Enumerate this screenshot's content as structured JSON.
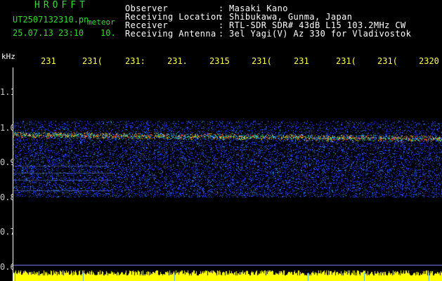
{
  "header": {
    "app_title": "HROFFT",
    "file_name": "UT2507132310.pn",
    "file_suffix": "meteor",
    "date_time": "25.07.13 23:10",
    "count": "10.",
    "info": [
      {
        "label": "Observer",
        "value": "Masaki Kano"
      },
      {
        "label": "Receiving Location",
        "value": "Shibukawa, Gunma, Japan"
      },
      {
        "label": "Receiver",
        "value": "RTL-SDR SDR# 43dB L15 103.2MHz CW"
      },
      {
        "label": "Receiving Antenna",
        "value": "3el Yagi(V) Az 330 for Vladivostok"
      }
    ],
    "separator": ":"
  },
  "plot": {
    "y_unit": "kHz",
    "x_ticks": [
      "231",
      "231(",
      "231:",
      "231.",
      "2315",
      "231(",
      "231",
      "231(",
      "231(",
      "2320"
    ],
    "y_ticks": [
      "1.1",
      "1.0",
      "0.9",
      "0.8",
      "0.7",
      "0.6"
    ],
    "echo_frequency_khz": 0.98,
    "noise_band_khz": [
      0.8,
      1.02
    ],
    "colors": {
      "background": "#000000",
      "noise": "#1f3cff",
      "signal": "#00e0a0",
      "peak": "#ff3020",
      "timeline": "#ffff00",
      "ticks_x": "#ffff55"
    }
  }
}
